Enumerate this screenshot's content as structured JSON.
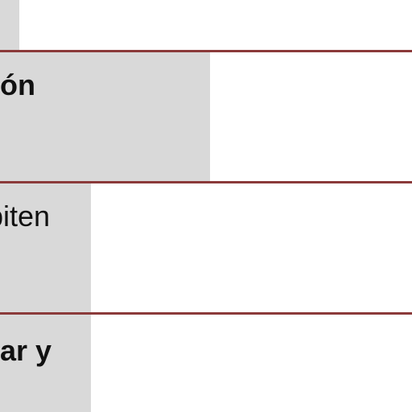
{
  "document": {
    "rows": [
      {
        "label": ""
      },
      {
        "label": "ón",
        "bold": true
      },
      {
        "label": "biten",
        "bold": false
      },
      {
        "label": "ar y",
        "bold": true
      }
    ]
  },
  "colors": {
    "rule": "#8b3a3a",
    "shade": "#d9d9d9",
    "text": "#111111",
    "background": "#ffffff"
  }
}
